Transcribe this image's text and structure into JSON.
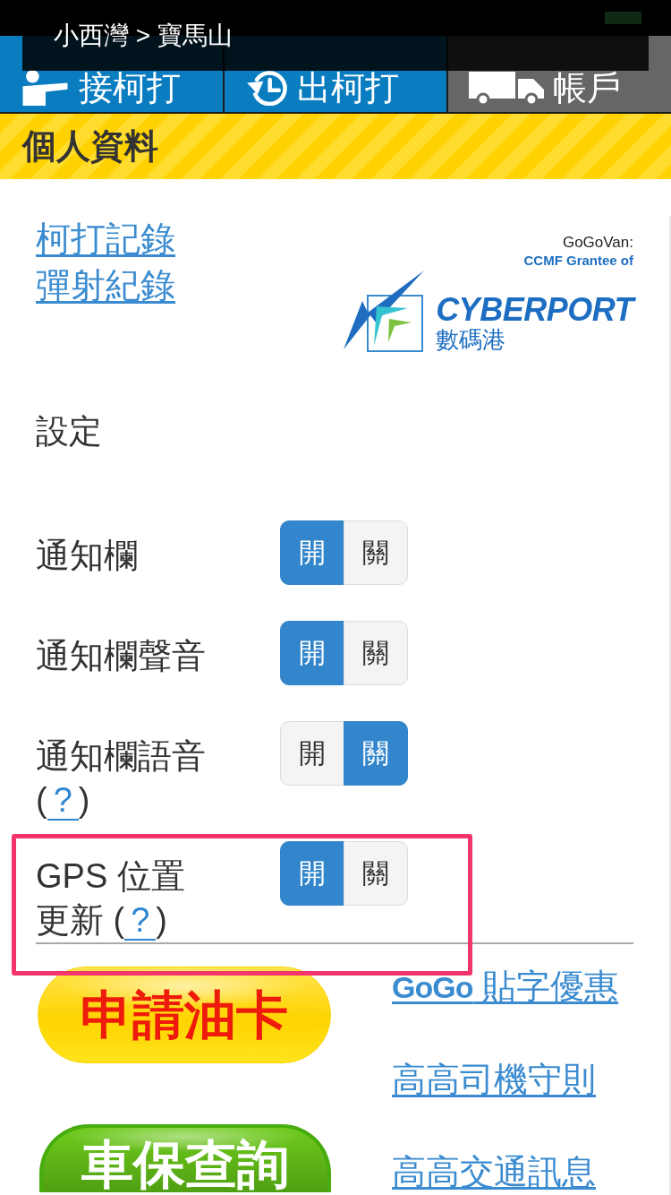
{
  "route_banner": {
    "text": "小西灣 > 寶馬山"
  },
  "tabs": [
    {
      "label": "接柯打",
      "selected": false
    },
    {
      "label": "出柯打",
      "selected": false
    },
    {
      "label": "帳戶",
      "selected": true
    }
  ],
  "page_header": {
    "title": "個人資料"
  },
  "record_links": [
    {
      "label": "柯打記錄"
    },
    {
      "label": "彈射紀錄"
    }
  ],
  "sponsor": {
    "caption": "GoGoVan:",
    "grantee": "CCMF Grantee of",
    "logo_name": "CYBERPORT",
    "logo_subtitle": "數碼港"
  },
  "settings": {
    "title": "設定",
    "items": [
      {
        "label": "通知欄",
        "on_label": "開",
        "off_label": "關",
        "on": true,
        "highlighted": false
      },
      {
        "label": "通知欄聲音",
        "on_label": "開",
        "off_label": "關",
        "on": true,
        "highlighted": false
      },
      {
        "label": "通知欄語音",
        "help": {
          "open": "(",
          "link": "?",
          "close": ")"
        },
        "on_label": "開",
        "off_label": "關",
        "on": false,
        "highlighted": false
      },
      {
        "label": "GPS 位置更新",
        "help": {
          "open": "(",
          "link": "?",
          "close": ")"
        },
        "on_label": "開",
        "off_label": "關",
        "on": true,
        "highlighted": true
      }
    ]
  },
  "promo_buttons": [
    {
      "label": "申請油卡",
      "kind": "yellow"
    },
    {
      "label": "車保查詢",
      "kind": "green"
    }
  ],
  "info_links": [
    {
      "label": "**GoGo** 貼字優惠"
    },
    {
      "label": "高高司機守則"
    },
    {
      "label": "高高交通訊息"
    }
  ]
}
